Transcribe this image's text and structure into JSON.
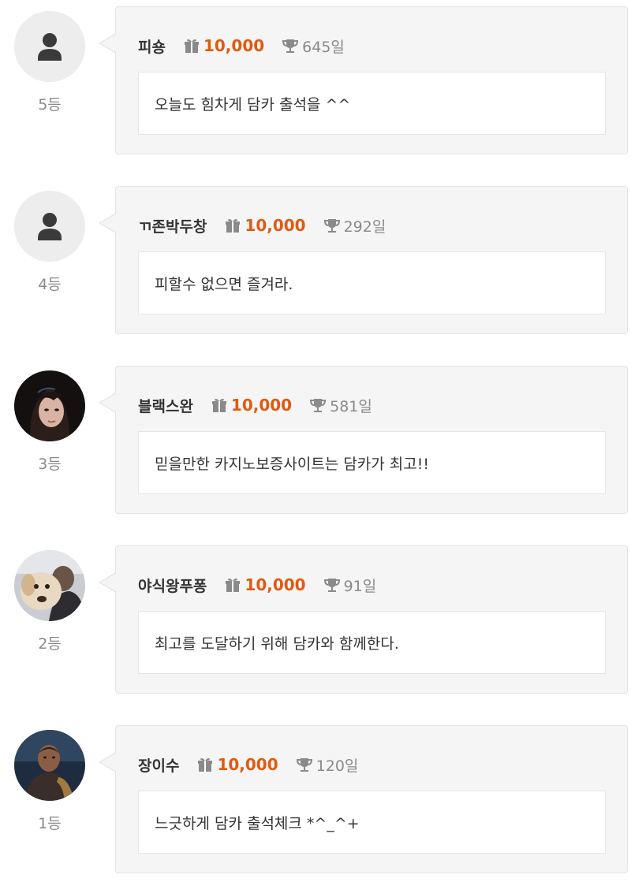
{
  "theme": {
    "points_color": "#e05a12",
    "icon_color": "#8a8a8a"
  },
  "entries": [
    {
      "nickname": "피숑",
      "points": "10,000",
      "days": "645일",
      "rank": "5등",
      "message": "오늘도 힘차게 담카 출석을 ^^",
      "avatar": "default-user-icon"
    },
    {
      "nickname": "ㄲ존박두창",
      "points": "10,000",
      "days": "292일",
      "rank": "4등",
      "message": "피할수 없으면 즐겨라.",
      "avatar": "default-user-icon"
    },
    {
      "nickname": "블랙스완",
      "points": "10,000",
      "days": "581일",
      "rank": "3등",
      "message": "믿을만한 카지노보증사이트는 담카가 최고!!",
      "avatar": "photo-woman-portrait"
    },
    {
      "nickname": "야식왕푸퐁",
      "points": "10,000",
      "days": "91일",
      "rank": "2등",
      "message": "최고를 도달하기 위해 담카와 함께한다.",
      "avatar": "photo-dog-and-person"
    },
    {
      "nickname": "장이수",
      "points": "10,000",
      "days": "120일",
      "rank": "1등",
      "message": "느긋하게 담카 출석체크 *^_^+",
      "avatar": "photo-man-portrait"
    }
  ]
}
